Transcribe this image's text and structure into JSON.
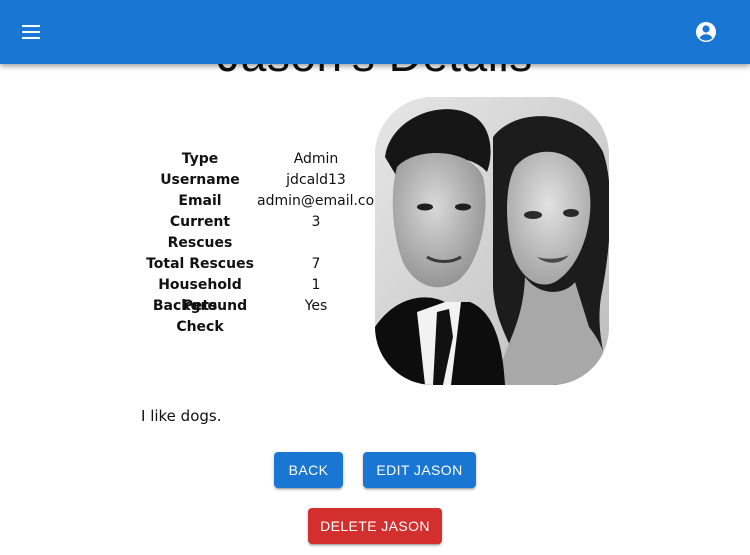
{
  "appbar": {
    "menu_icon": "menu-icon",
    "account_icon": "account-circle-icon",
    "color": "#1976d2"
  },
  "page": {
    "title": "Jason's Details"
  },
  "details": [
    {
      "label": "Type",
      "value": "Admin"
    },
    {
      "label": "Username",
      "value": "jdcald13"
    },
    {
      "label": "Email",
      "value": "admin@email.com"
    },
    {
      "label": "Current Rescues",
      "value": "3"
    },
    {
      "label": "Total Rescues",
      "value": "7"
    },
    {
      "label": "Household Pets",
      "value": "1"
    },
    {
      "label": "Background Check",
      "value": "Yes"
    }
  ],
  "bio": "I like dogs.",
  "buttons": {
    "back": "Back",
    "edit": "Edit Jason",
    "delete": "Delete Jason"
  },
  "colors": {
    "primary": "#1976d2",
    "danger": "#d32f2f"
  }
}
